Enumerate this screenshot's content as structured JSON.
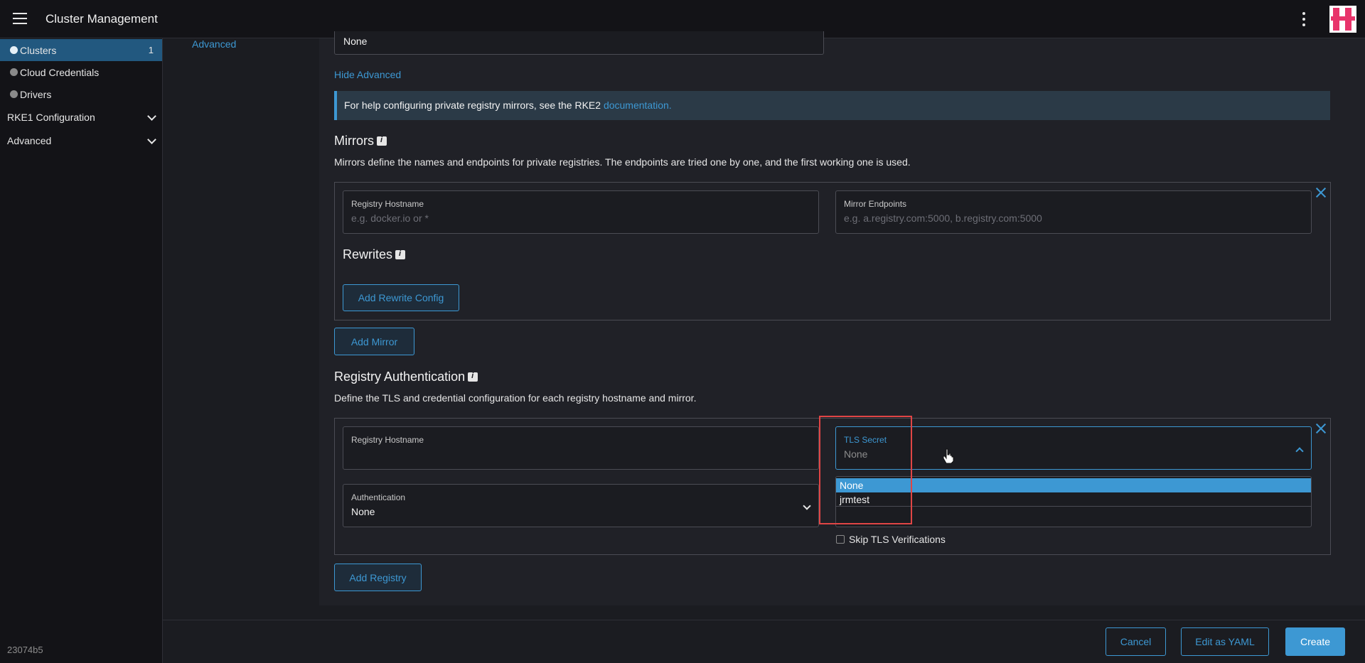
{
  "header": {
    "title": "Cluster Management"
  },
  "sidebar": {
    "items": [
      {
        "label": "Clusters",
        "count": "1"
      },
      {
        "label": "Cloud Credentials"
      },
      {
        "label": "Drivers"
      }
    ],
    "groups": [
      {
        "label": "RKE1 Configuration"
      },
      {
        "label": "Advanced"
      }
    ],
    "build": "23074b5"
  },
  "left_nav": {
    "advanced": "Advanced"
  },
  "top_field": {
    "value": "None"
  },
  "hide_advanced": "Hide Advanced",
  "banner": {
    "text": "For help configuring private registry mirrors, see the RKE2 ",
    "link": "documentation."
  },
  "mirrors": {
    "title": "Mirrors",
    "description": "Mirrors define the names and endpoints for private registries. The endpoints are tried one by one, and the first working one is used.",
    "hostname_label": "Registry Hostname",
    "hostname_placeholder": "e.g. docker.io or *",
    "endpoints_label": "Mirror Endpoints",
    "endpoints_placeholder": "e.g. a.registry.com:5000, b.registry.com:5000",
    "rewrites_title": "Rewrites",
    "add_rewrite": "Add Rewrite Config",
    "add_mirror": "Add Mirror"
  },
  "registry_auth": {
    "title": "Registry Authentication",
    "description": "Define the TLS and credential configuration for each registry hostname and mirror.",
    "hostname_label": "Registry Hostname",
    "tls_label": "TLS Secret",
    "tls_placeholder": "None",
    "tls_options": [
      "None",
      "jrmtest"
    ],
    "auth_label": "Authentication",
    "auth_value": "None",
    "skip_tls": "Skip TLS Verifications",
    "add_registry": "Add Registry"
  },
  "footer": {
    "cancel": "Cancel",
    "edit_yaml": "Edit as YAML",
    "create": "Create"
  },
  "colors": {
    "accent": "#3d98d3",
    "active_nav": "#22587f",
    "highlight_box": "#e04545"
  }
}
